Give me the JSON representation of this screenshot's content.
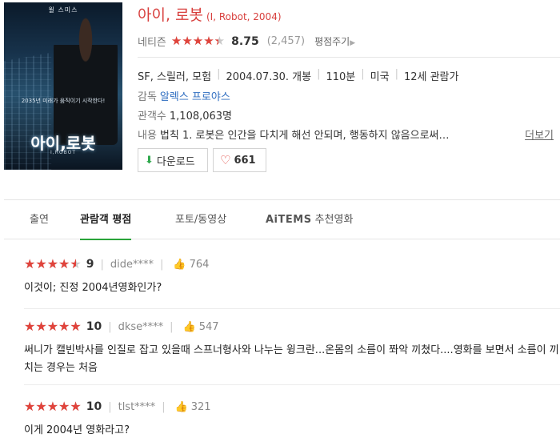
{
  "poster": {
    "top_name": "윌 스미스",
    "tagline": "2035년 미래가 움직이기 시작한다!",
    "title": "아이,로봇",
    "subtitle": "I,ROBOT"
  },
  "movie": {
    "title_ko": "아이, 로봇",
    "title_orig": "(I, Robot, 2004)",
    "rating_label": "네티즌",
    "rating_fraction": 0.875,
    "rating_score": "8.75",
    "rating_count": "(2,457)",
    "rate_link": "평점주기",
    "genre": "SF, 스릴러, 모험",
    "release": "2004.07.30. 개봉",
    "runtime": "110분",
    "country": "미국",
    "age": "12세 관람가",
    "director_label": "감독",
    "director": "알렉스 프로야스",
    "audience_label": "관객수",
    "audience": "1,108,063명",
    "plot_label": "내용",
    "plot": "법칙 1. 로봇은 인간을 다치게 해선 안되며, 행동하지 않음으로써…",
    "more_label": "더보기",
    "download_label": "다운로드",
    "like_count": "661"
  },
  "tabs": [
    {
      "label": "출연"
    },
    {
      "label": "관람객 평점"
    },
    {
      "label": "포토/동영상"
    },
    {
      "brand": "AiTEMS",
      "label": "추천영화"
    }
  ],
  "reviews": [
    {
      "score": "9",
      "fraction": 0.9,
      "user": "dide****",
      "likes": "764",
      "text": "이것이; 진정 2004년영화인가?"
    },
    {
      "score": "10",
      "fraction": 1.0,
      "user": "dkse****",
      "likes": "547",
      "text": "써니가 캘빈박사를 인질로 잡고 있을때 스프너형사와 나누는 윙크란...온몸의 소름이 쫘악 끼쳤다....영화를 보면서 소름이 끼치는 경우는 처음"
    },
    {
      "score": "10",
      "fraction": 1.0,
      "user": "tlst****",
      "likes": "321",
      "text": "이게 2004년 영화라고?"
    }
  ],
  "colors": {
    "accent_red": "#d8403e",
    "star_red": "#e0433b",
    "tab_green": "#2aa43a",
    "link_blue": "#2e6dc0"
  },
  "icons": {
    "download": "download-arrow-icon",
    "like": "heart-icon",
    "thumb": "thumbs-up-icon",
    "star": "star-icon"
  }
}
